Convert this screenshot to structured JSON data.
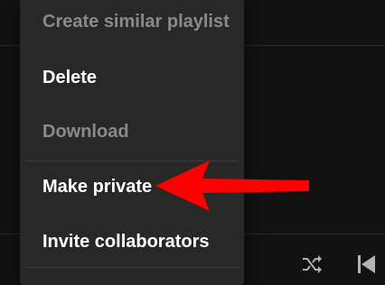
{
  "context_menu": {
    "items": [
      {
        "label": "Create similar playlist",
        "enabled": false
      },
      {
        "label": "Delete",
        "enabled": true
      },
      {
        "label": "Download",
        "enabled": false
      },
      {
        "label": "Make private",
        "enabled": true
      },
      {
        "label": "Invite collaborators",
        "enabled": true
      }
    ]
  },
  "annotation": {
    "arrow_color": "#ff0000",
    "points_to": "Make private"
  },
  "player_controls": {
    "icons": [
      "shuffle-icon",
      "skip-back-icon"
    ]
  },
  "colors": {
    "background": "#121212",
    "menu_background": "#282828",
    "text_enabled": "#ffffff",
    "text_disabled": "#8a8a8a"
  }
}
